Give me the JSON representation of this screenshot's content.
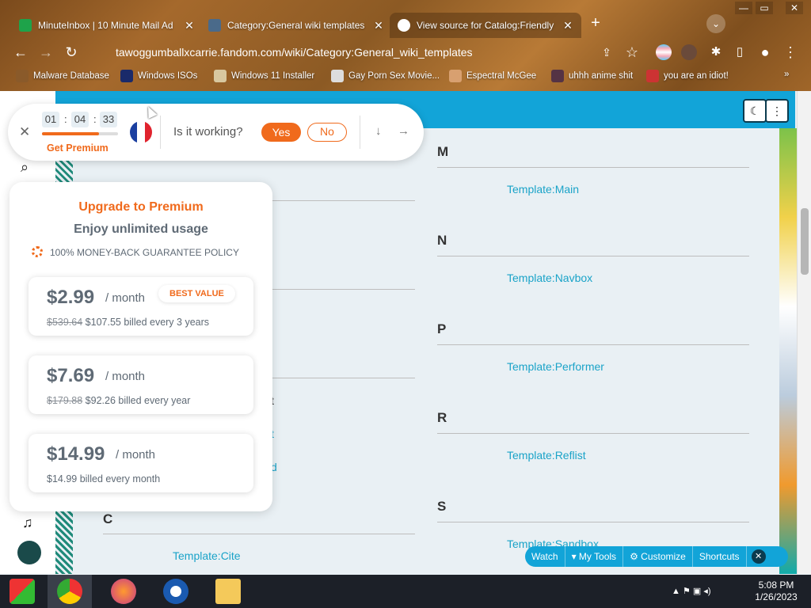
{
  "browser": {
    "tabs": [
      {
        "title": "MinuteInbox | 10 Minute Mail Ad",
        "active": false,
        "favicon_color": "#1ea34a"
      },
      {
        "title": "Category:General wiki templates",
        "active": false,
        "favicon_color": "#4a6a8a"
      },
      {
        "title": "View source for Catalog:Friendly",
        "active": true,
        "favicon_color": "#ffffff"
      }
    ],
    "close_glyph": "✕",
    "new_tab_glyph": "+",
    "url": "tawoggumballxcarrie.fandom.com/wiki/Category:General_wiki_templates",
    "bookmarks": [
      {
        "label": "Malware Database",
        "icon_color": "#8a5a2a"
      },
      {
        "label": "Windows ISOs",
        "icon_color": "#1a2a6a"
      },
      {
        "label": "Windows 11 Installer",
        "icon_color": "#d8c8a0"
      },
      {
        "label": "Gay Porn Sex Movie...",
        "icon_color": "#ddd"
      },
      {
        "label": "Espectral McGee",
        "icon_color": "#d8a070"
      },
      {
        "label": "uhhh anime shit",
        "icon_color": "#553344"
      },
      {
        "label": "you are an idiot!",
        "icon_color": "#cc3333"
      }
    ]
  },
  "widget": {
    "timer": {
      "hours": "01",
      "minutes": "04",
      "seconds": "33"
    },
    "progress": 0.75,
    "get_premium": "Get Premium",
    "question": "Is it working?",
    "yes": "Yes",
    "no": "No",
    "close_glyph": "✕",
    "down_glyph": "↓",
    "next_glyph": "→"
  },
  "premium": {
    "title": "Upgrade to Premium",
    "subtitle": "Enjoy unlimited usage",
    "guarantee": "100% MONEY-BACK GUARANTEE POLICY",
    "plans": [
      {
        "price": "$2.99",
        "per": "/ month",
        "old": "$539.64",
        "billed": "$107.55 billed every 3 years",
        "badge": "BEST VALUE"
      },
      {
        "price": "$7.69",
        "per": "/ month",
        "old": "$179.88",
        "billed": "$92.26 billed every year",
        "badge": ""
      },
      {
        "price": "$14.99",
        "per": "/ month",
        "old": "",
        "billed": "$14.99 billed every month",
        "badge": ""
      }
    ]
  },
  "wiki": {
    "sections_right": [
      {
        "letter": "M",
        "link": "Template:Main"
      },
      {
        "letter": "N",
        "link": "Template:Navbox"
      },
      {
        "letter": "P",
        "link": "Template:Performer"
      },
      {
        "letter": "R",
        "link": "Template:Reflist"
      },
      {
        "letter": "S",
        "link": "Template:Sandbox"
      }
    ],
    "sections_left": [
      {
        "letter": "C",
        "link": "Template:Cite"
      }
    ],
    "partial_fragments": [
      "t",
      "t",
      "d"
    ],
    "toolbar": [
      "Watch",
      "My Tools",
      "Customize",
      "Shortcuts"
    ]
  },
  "taskbar": {
    "time": "5:08 PM",
    "date": "1/26/2023"
  },
  "colors": {
    "accent_orange": "#f06a1c",
    "fandom_blue": "#12a4d8",
    "link": "#1aa3c8"
  }
}
